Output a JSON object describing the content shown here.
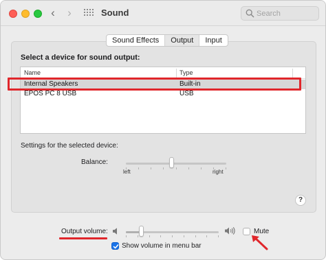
{
  "window": {
    "title": "Sound"
  },
  "search": {
    "placeholder": "Search"
  },
  "tabs": [
    {
      "label": "Sound Effects",
      "active": false
    },
    {
      "label": "Output",
      "active": true
    },
    {
      "label": "Input",
      "active": false
    }
  ],
  "output": {
    "heading": "Select a device for sound output:",
    "columns": {
      "name": "Name",
      "type": "Type"
    },
    "devices": [
      {
        "name": "Internal Speakers",
        "type": "Built-in",
        "selected": true
      },
      {
        "name": "EPOS PC 8 USB",
        "type": "USB",
        "selected": false
      }
    ],
    "settings_label": "Settings for the selected device:",
    "balance": {
      "label": "Balance:",
      "left": "left",
      "right": "right",
      "value": 0.5
    },
    "help": "?"
  },
  "volume": {
    "label": "Output volume:",
    "level": 0.15,
    "mute_label": "Mute",
    "muted": false,
    "menubar_label": "Show volume in menu bar",
    "menubar_checked": true
  },
  "colors": {
    "annotation": "#e0262b",
    "checkbox_accent": "#1a73e8",
    "selected_row": "#d7d7d7"
  },
  "icons": {
    "traffic": [
      "close-icon",
      "minimize-icon",
      "zoom-icon"
    ],
    "nav": [
      "chevron-left-icon",
      "chevron-right-icon"
    ],
    "grid": "grid-icon",
    "search": "search-icon",
    "speaker_low": "speaker-low-icon",
    "speaker_high": "speaker-high-icon",
    "arrow": "arrow-icon"
  }
}
